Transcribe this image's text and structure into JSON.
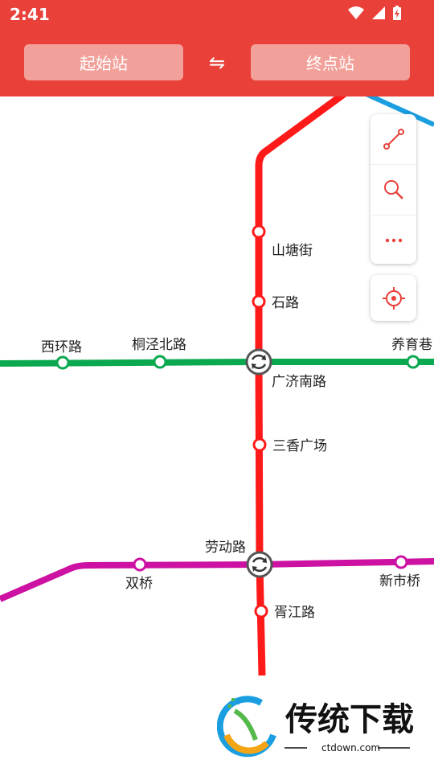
{
  "status_bar": {
    "time": "2:41"
  },
  "header": {
    "start_label": "起始站",
    "end_label": "终点站",
    "swap_symbol": "⇋"
  },
  "toolbar": {
    "icons": [
      "route-icon",
      "search-icon",
      "more-icon"
    ],
    "locate_icon": "locate-icon"
  },
  "colors": {
    "header": "#e9403a",
    "line_red": "#ff1a1a",
    "line_green": "#0aa84f",
    "line_magenta": "#cc11a3",
    "line_blue": "#1a9ee0"
  },
  "map": {
    "stations": {
      "shantangjie": "山塘街",
      "shilu": "石路",
      "xihuanlu": "西环路",
      "tongjingbeilu": "桐泾北路",
      "guangjinanlu": "广济南路",
      "yangyuxiang": "养育巷",
      "sanxiangguangchang": "三香广场",
      "laodonglu": "劳动路",
      "shuangqiao": "双桥",
      "xinshiqiao": "新市桥",
      "xujianglu": "胥江路"
    }
  },
  "watermark": {
    "title": "传统下载",
    "url": "ctdown.com"
  }
}
